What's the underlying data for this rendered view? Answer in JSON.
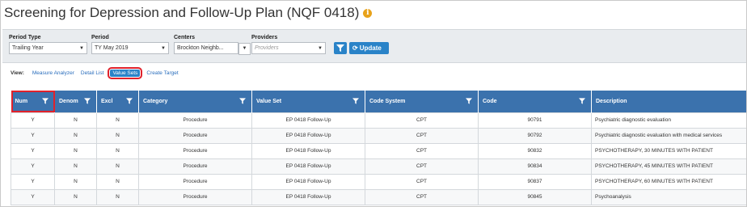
{
  "page": {
    "title": "Screening for Depression and Follow-Up Plan (NQF 0418)"
  },
  "filters": {
    "period_type": {
      "label": "Period Type",
      "value": "Trailing Year"
    },
    "period": {
      "label": "Period",
      "value": "TY May 2019"
    },
    "centers": {
      "label": "Centers",
      "value": "Brockton Neighb..."
    },
    "providers": {
      "label": "Providers",
      "placeholder": "Providers"
    },
    "update_label": "Update"
  },
  "view": {
    "label": "View:",
    "links": [
      "Measure Analyzer",
      "Detail List",
      "Value Sets",
      "Create Target"
    ],
    "active": "Value Sets"
  },
  "table": {
    "columns": [
      "Num",
      "Denom",
      "Excl",
      "Category",
      "Value Set",
      "Code System",
      "Code",
      "Description"
    ],
    "rows": [
      [
        "Y",
        "N",
        "N",
        "Procedure",
        "EP 0418 Follow-Up",
        "CPT",
        "90791",
        "Psychiatric diagnostic evaluation"
      ],
      [
        "Y",
        "N",
        "N",
        "Procedure",
        "EP 0418 Follow-Up",
        "CPT",
        "90792",
        "Psychiatric diagnostic evaluation with medical services"
      ],
      [
        "Y",
        "N",
        "N",
        "Procedure",
        "EP 0418 Follow-Up",
        "CPT",
        "90832",
        "PSYCHOTHERAPY, 30 MINUTES WITH PATIENT"
      ],
      [
        "Y",
        "N",
        "N",
        "Procedure",
        "EP 0418 Follow-Up",
        "CPT",
        "90834",
        "PSYCHOTHERAPY, 45 MINUTES WITH PATIENT"
      ],
      [
        "Y",
        "N",
        "N",
        "Procedure",
        "EP 0418 Follow-Up",
        "CPT",
        "90837",
        "PSYCHOTHERAPY, 60 MINUTES WITH PATIENT"
      ],
      [
        "Y",
        "N",
        "N",
        "Procedure",
        "EP 0418 Follow-Up",
        "CPT",
        "90845",
        "Psychoanalysis"
      ]
    ]
  },
  "colors": {
    "header_blue": "#3b72ad",
    "button_blue": "#2a83c8",
    "highlight_red": "#e0222c",
    "info_orange": "#e8a21a"
  }
}
